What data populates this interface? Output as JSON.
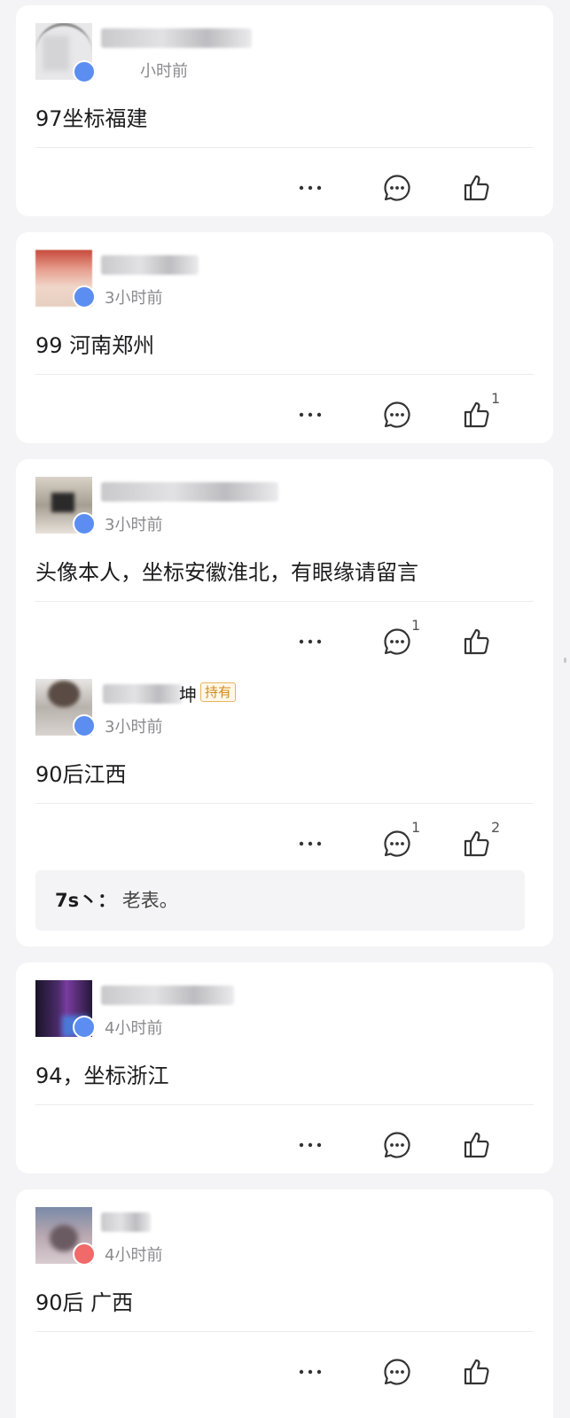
{
  "posts": [
    {
      "time": "小时前",
      "content": "97坐标福建",
      "reply_count": "",
      "like_count": ""
    },
    {
      "time": "3小时前",
      "content": "99 河南郑州",
      "reply_count": "",
      "like_count": "1"
    },
    {
      "time": "3小时前",
      "content": "头像本人，坐标安徽淮北，有眼缘请留言",
      "reply_count": "1",
      "like_count": ""
    },
    {
      "name_suffix": "坤",
      "tag": "持有",
      "time": "3小时前",
      "content": "90后江西",
      "reply_count": "1",
      "like_count": "2",
      "reply_preview": {
        "author": "7s丶：",
        "text": "老表。"
      }
    },
    {
      "time": "4小时前",
      "content": "94，坐标浙江",
      "reply_count": "",
      "like_count": ""
    },
    {
      "time": "4小时前",
      "content": "90后 广西",
      "reply_count": "",
      "like_count": ""
    }
  ],
  "icons": {
    "more": "more-dots-icon",
    "reply": "comment-bubble-icon",
    "like": "thumbs-up-icon"
  },
  "colors": {
    "background": "#f4f4f6",
    "card": "#ffffff",
    "badge_blue": "#5b8ef0",
    "badge_red": "#f06a6a",
    "holder_tag": "#d08a1c"
  }
}
